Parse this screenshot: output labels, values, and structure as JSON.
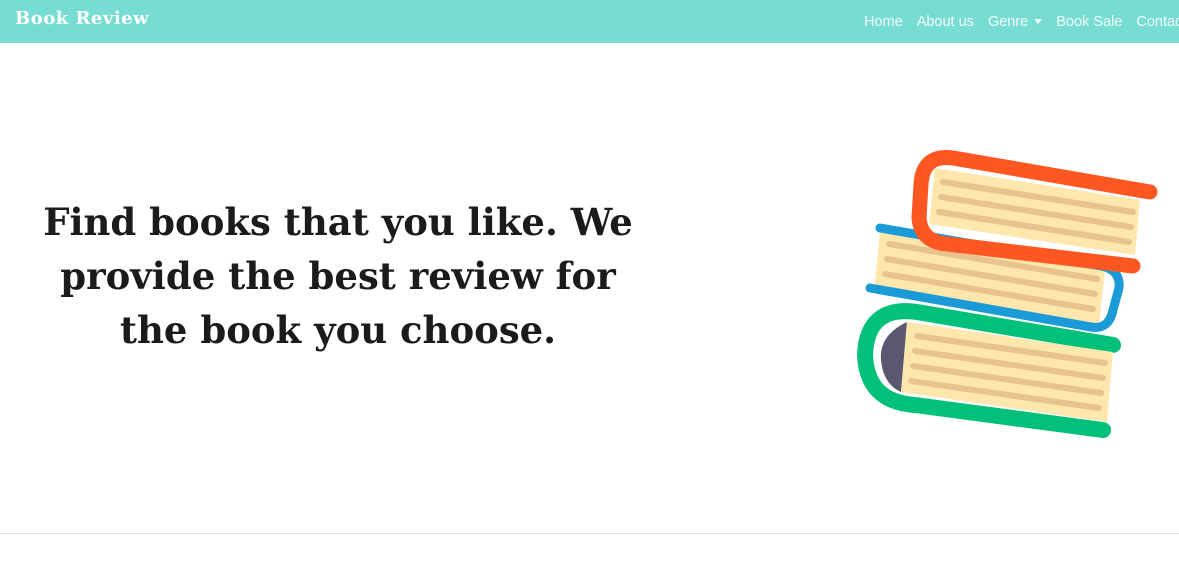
{
  "navbar": {
    "brand": "Book Review",
    "links": [
      {
        "label": "Home"
      },
      {
        "label": "About us"
      },
      {
        "label": "Genre",
        "has_dropdown": true
      },
      {
        "label": "Book Sale"
      },
      {
        "label": "Contac"
      }
    ]
  },
  "hero": {
    "text": "Find books that you like. We provide the best review for the book you choose.",
    "illustration": "stacked-books-icon"
  },
  "colors": {
    "navbar_bg": "#77ddd3",
    "top_book": "#ff5722",
    "middle_book": "#1a9ad6",
    "bottom_book": "#00c07a",
    "pages": "#fde7ad",
    "page_lines": "#e8c28f"
  }
}
